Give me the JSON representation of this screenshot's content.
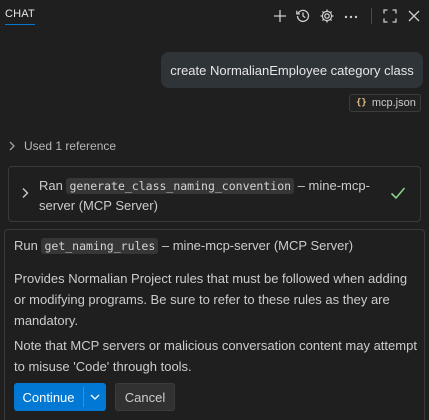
{
  "header": {
    "tab_label": "CHAT",
    "icons": [
      "plus-icon",
      "history-icon",
      "gear-icon",
      "ellipsis-icon",
      "maximize-icon",
      "close-icon"
    ]
  },
  "conversation": {
    "user_message": "create NormalianEmployee category class",
    "attachment": {
      "label": "mcp.json",
      "icon": "braces-icon"
    },
    "references_label": "Used 1 reference",
    "tool_run": {
      "prefix": "Ran",
      "tool_name": "generate_class_naming_convention",
      "suffix": "– mine-mcp-server (MCP Server)",
      "status_icon": "check-icon"
    }
  },
  "confirmation": {
    "run_prefix": "Run",
    "tool_name": "get_naming_rules",
    "run_suffix": "– mine-mcp-server (MCP Server)",
    "description": "Provides Normalian Project rules that must be followed when adding or modifying programs. Be sure to refer to these rules as they are mandatory.",
    "note": "Note that MCP servers or malicious conversation content may attempt to misuse 'Code' through tools.",
    "continue_label": "Continue",
    "cancel_label": "Cancel"
  },
  "colors": {
    "background": "#1f1f1f",
    "accent": "#0078d4",
    "success": "#89d185",
    "bubble": "#2f3439"
  }
}
